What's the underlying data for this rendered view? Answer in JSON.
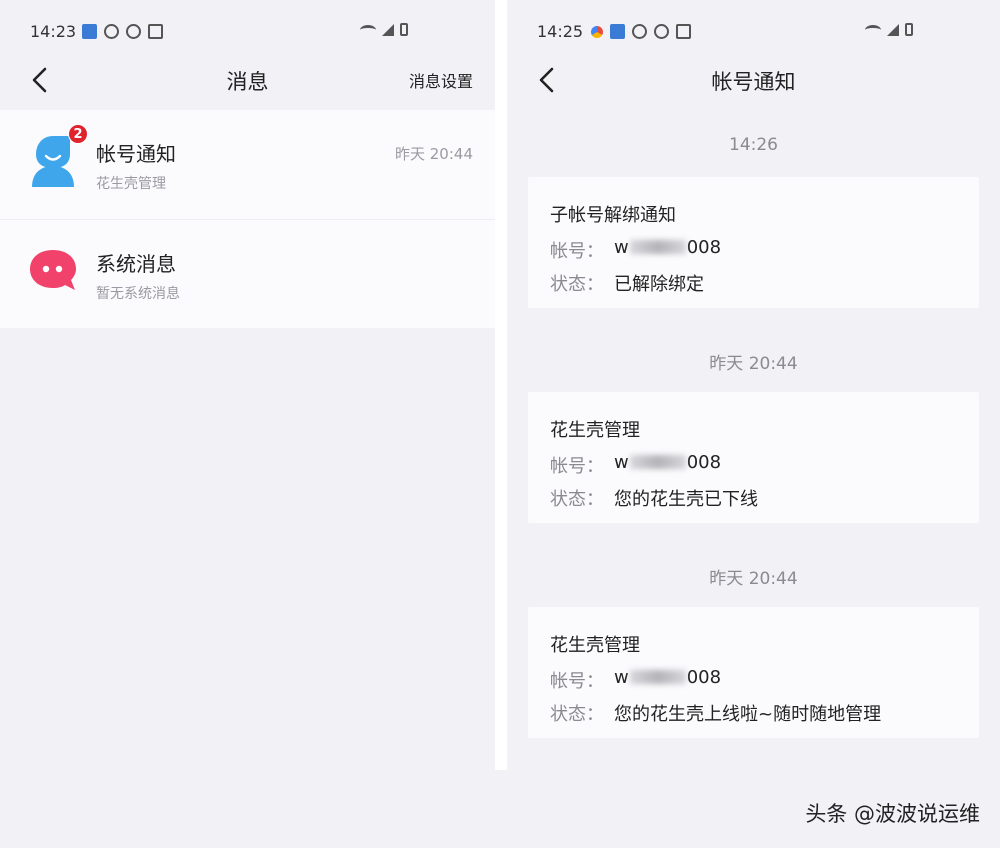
{
  "left": {
    "status_time": "14:23",
    "nav": {
      "title": "消息",
      "action": "消息设置"
    },
    "items": [
      {
        "title": "帐号通知",
        "subtitle": "花生壳管理",
        "time": "昨天 20:44",
        "badge": "2",
        "icon": "user-avatar-icon",
        "color": "#3fa6ec"
      },
      {
        "title": "系统消息",
        "subtitle": "暂无系统消息",
        "time": "",
        "icon": "chat-bubble-icon",
        "color": "#f0426a"
      }
    ]
  },
  "right": {
    "status_time": "14:25",
    "nav": {
      "title": "帐号通知"
    },
    "groups": [
      {
        "time": "14:26",
        "card": {
          "title": "子帐号解绑通知",
          "account_label": "帐号：",
          "account_prefix": "w",
          "account_suffix": "008",
          "status_label": "状态：",
          "status_value": "已解除绑定"
        }
      },
      {
        "time": "昨天 20:44",
        "card": {
          "title": "花生壳管理",
          "account_label": "帐号：",
          "account_prefix": "w",
          "account_suffix": "008",
          "status_label": "状态：",
          "status_value": "您的花生壳已下线"
        }
      },
      {
        "time": "昨天 20:44",
        "card": {
          "title": "花生壳管理",
          "account_label": "帐号：",
          "account_prefix": "w",
          "account_suffix": "008",
          "status_label": "状态：",
          "status_value": "您的花生壳上线啦~随时随地管理"
        }
      }
    ]
  },
  "watermark": "头条 @波波说运维"
}
